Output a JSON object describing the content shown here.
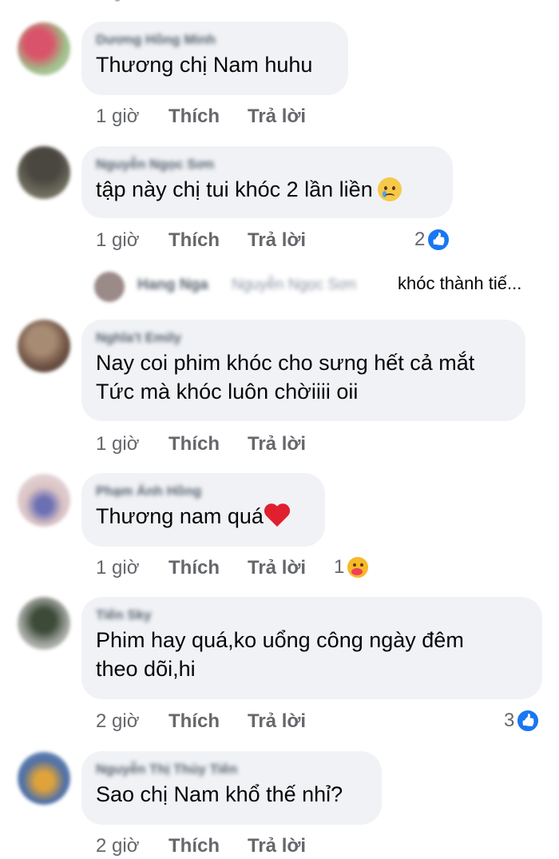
{
  "comments": [
    {
      "author": "Dương Hồng Minh",
      "text_lines": [
        "Thương chị Nam huhu"
      ],
      "time": "1 giờ",
      "like": "Thích",
      "reply": "Trả lời"
    },
    {
      "author": "Nguyễn Ngọc Sơn",
      "text_lines": [
        "tập này chị tui khóc 2 lần liền"
      ],
      "time": "1 giờ",
      "like": "Thích",
      "reply": "Trả lời",
      "reaction_count": "2",
      "reaction_icon": "like-icon"
    },
    {
      "author": "Nghĩa't Emily",
      "text_lines": [
        "Nay coi phim khóc cho sưng hết cả mắt",
        "Tức mà khóc luôn chờiiii oii"
      ],
      "time": "1 giờ",
      "like": "Thích",
      "reply": "Trả lời"
    },
    {
      "author": "Phạm Ánh Hồng",
      "text_lines": [
        "Thương nam quá"
      ],
      "time": "1 giờ",
      "like": "Thích",
      "reply": "Trả lời",
      "reaction_count": "1",
      "reaction_icon": "care-icon"
    },
    {
      "author": "Tiến Sky",
      "text_lines": [
        "Phim hay quá,ko uổng công ngày đêm",
        "theo dõi,hi"
      ],
      "time": "2 giờ",
      "like": "Thích",
      "reply": "Trả lời",
      "reaction_count": "3",
      "reaction_icon": "like-icon"
    },
    {
      "author": "Nguyễn Thị Thủy Tiên",
      "text_lines": [
        "Sao chị Nam khổ thế nhỉ?"
      ],
      "time": "2 giờ",
      "like": "Thích",
      "reply": "Trả lời"
    }
  ],
  "reply_preview": {
    "author": "Hang Nga",
    "mention": "Nguyễn Ngọc Sơn",
    "text": "khóc thành tiế..."
  },
  "colors": {
    "bubble": "#f0f2f5",
    "action_text": "#65676b",
    "like_blue": "#1877f2",
    "heart_red": "#e0202e"
  }
}
